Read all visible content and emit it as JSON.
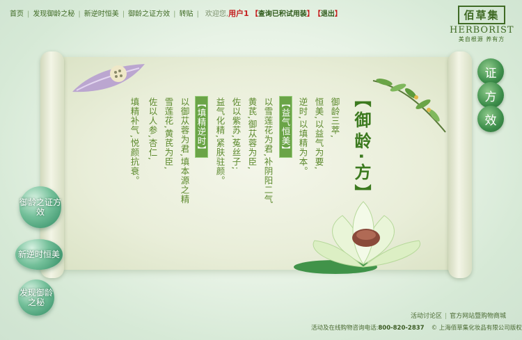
{
  "nav": {
    "items": [
      "首页",
      "发现御龄之秘",
      "新逆时恒美",
      "御龄之证方效",
      "转贴"
    ],
    "welcome": "欢迎您,",
    "username": "用户1",
    "query_label": "查询已积试用装",
    "logout_label": "退出",
    "open_bracket": "【",
    "close_bracket": "】"
  },
  "logo": {
    "cn": "佰草集",
    "en": "HERBORIST",
    "tagline": "美自根源 养有方"
  },
  "scroll": {
    "title": "【御龄·方】",
    "columns": [
      {
        "text": "御龄三萃,",
        "hl": ""
      },
      {
        "text": "恒美,以益气为要,",
        "hl": ""
      },
      {
        "text": "逆时,以填精为本。",
        "hl": ""
      },
      {
        "text": "",
        "hl": "【益气恒美】"
      },
      {
        "text": "以雪莲花为君,补阴阳二气",
        "hl": ""
      },
      {
        "text": "黄芪,御苁蓉为臣,",
        "hl": ""
      },
      {
        "text": "佐以紫苏,菟丝子;",
        "hl": ""
      },
      {
        "text": "益气化精,紧肤驻颜。",
        "hl": ""
      },
      {
        "text": "",
        "hl": "【填精逆时】"
      },
      {
        "text": "以御苁蓉为君,填本源之精",
        "hl": ""
      },
      {
        "text": "雪莲花,黄芪为臣,",
        "hl": ""
      },
      {
        "text": "佐以人参,杏仁,",
        "hl": ""
      },
      {
        "text": "填精补气,悦颜抗衰。",
        "hl": ""
      }
    ]
  },
  "right_buttons": [
    "证",
    "方",
    "效"
  ],
  "left_nav": [
    "御龄之证方效",
    "新逆时恒美",
    "发现御龄之秘"
  ],
  "footer": {
    "links": [
      "活动讨论区",
      "官方网站暨购物商城"
    ],
    "info": "活动及在线购物咨询电话:",
    "phone": "800-820-2837",
    "copyright": "© 上海佰草集化妆品有限公司版权所有"
  },
  "colors": {
    "accent": "#3f6a24",
    "highlight": "#c41f1f",
    "text_green": "#5d8a2e"
  }
}
